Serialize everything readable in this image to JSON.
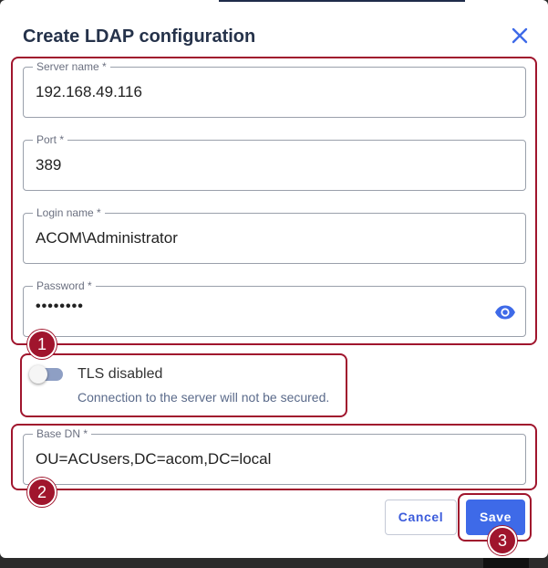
{
  "dialog": {
    "title": "Create LDAP configuration"
  },
  "fields": {
    "server_name": {
      "label": "Server name *",
      "value": "192.168.49.116"
    },
    "port": {
      "label": "Port *",
      "value": "389"
    },
    "login_name": {
      "label": "Login name *",
      "value": "ACOM\\Administrator"
    },
    "password": {
      "label": "Password *",
      "value": "••••••••"
    },
    "base_dn": {
      "label": "Base DN *",
      "value": "OU=ACUsers,DC=acom,DC=local"
    }
  },
  "tls": {
    "label": "TLS disabled",
    "hint": "Connection to the server will not be secured.",
    "enabled": false
  },
  "buttons": {
    "cancel": "Cancel",
    "save": "Save"
  },
  "callouts": [
    "1",
    "2",
    "3"
  ],
  "colors": {
    "accent": "#3e6ae8",
    "highlight": "#a0152d",
    "title": "#25324a"
  },
  "icons": {
    "close": "close-icon",
    "password_visibility": "eye-icon"
  }
}
